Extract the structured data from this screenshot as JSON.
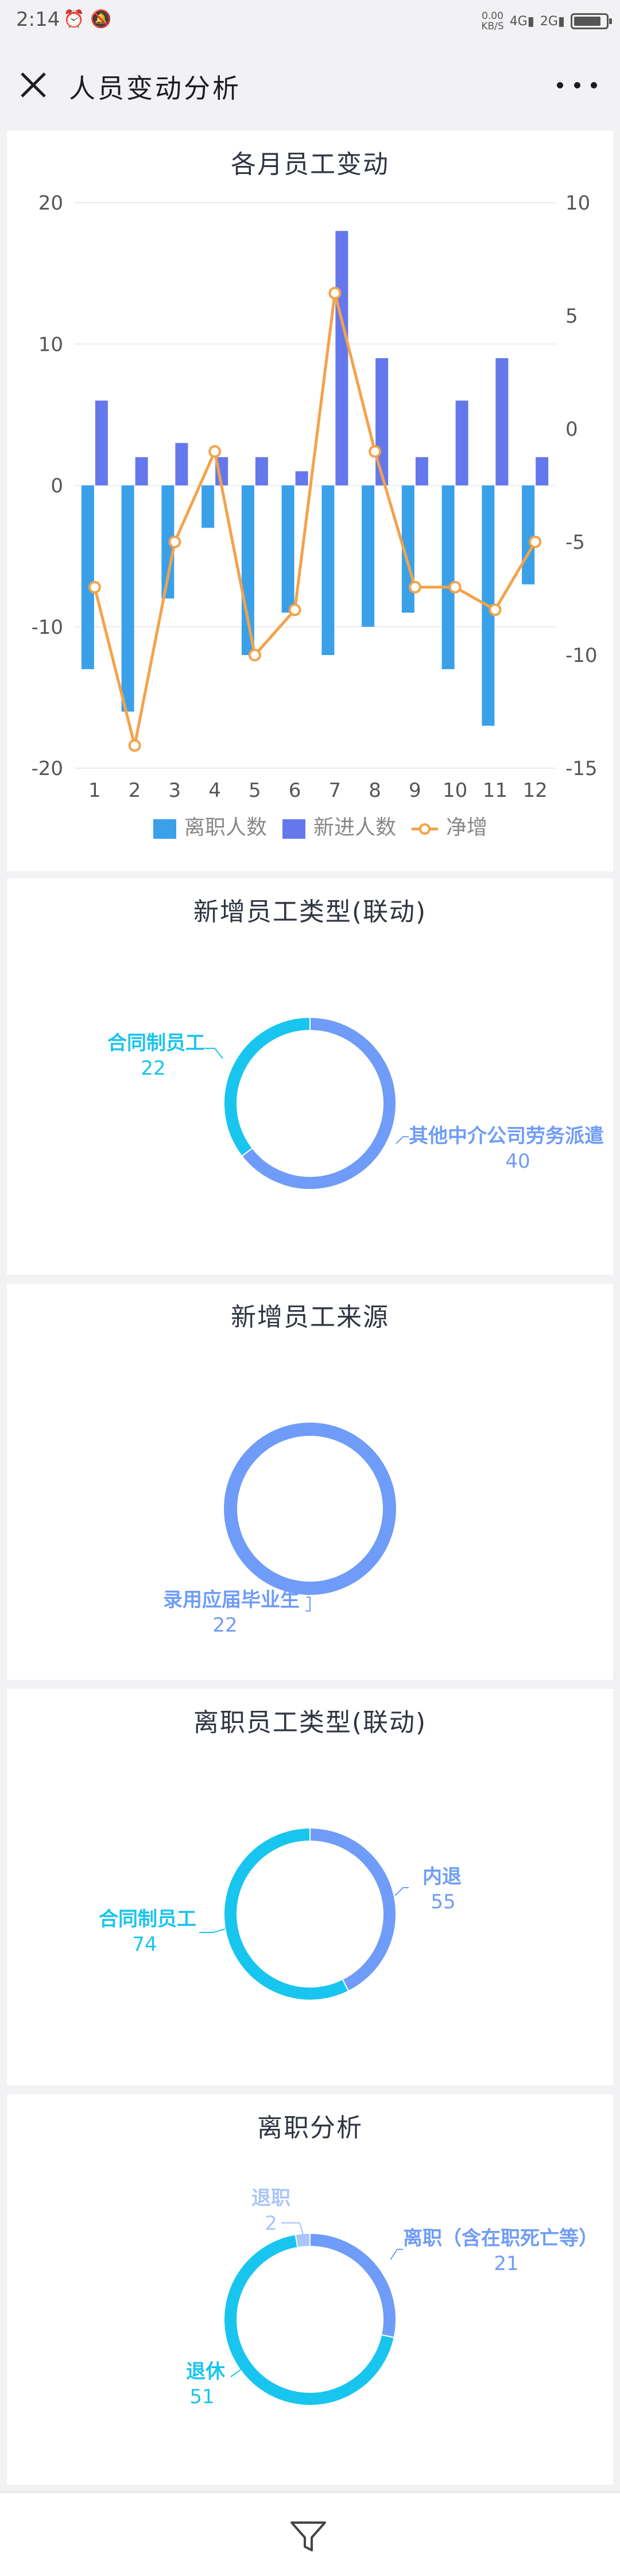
{
  "status_bar": {
    "time": "2:14",
    "net_speed_value": "0.00",
    "net_speed_unit": "KB/S",
    "signal_1": "4G",
    "signal_2": "2G",
    "battery_level": 0.85
  },
  "header": {
    "title": "人员变动分析"
  },
  "colors": {
    "left_bar": "#3aa0e8",
    "right_bar": "#6478ec",
    "line": "#f4a24a",
    "donut_cyan": "#18c5ee",
    "donut_blue": "#6f9cf8",
    "donut_light": "#a9c5fa"
  },
  "monthly": {
    "title": "各月员工变动",
    "chart_data": {
      "type": "bar",
      "categories": [
        "1",
        "2",
        "3",
        "4",
        "5",
        "6",
        "7",
        "8",
        "9",
        "10",
        "11",
        "12"
      ],
      "series": [
        {
          "name": "离职人数",
          "axis": "left",
          "values": [
            -13,
            -16,
            -8,
            -3,
            -12,
            -9,
            -12,
            -10,
            -9,
            -13,
            -17,
            -7
          ]
        },
        {
          "name": "新进人数",
          "axis": "left",
          "values": [
            6,
            2,
            3,
            2,
            2,
            1,
            18,
            9,
            2,
            6,
            9,
            2
          ]
        },
        {
          "name": "净增",
          "axis": "right",
          "type": "line",
          "values": [
            -7,
            -14,
            -5,
            -1,
            -10,
            -8,
            6,
            -1,
            -7,
            -7,
            -8,
            -5
          ]
        }
      ],
      "ylim_left": [
        -20,
        20
      ],
      "yticks_left": [
        "20",
        "10",
        "0",
        "-10",
        "-20"
      ],
      "ylim_right": [
        -15,
        10
      ],
      "yticks_right": [
        "10",
        "5",
        "0",
        "-5",
        "-10",
        "-15"
      ],
      "legend_position": "bottom-center"
    }
  },
  "new_type": {
    "title": "新增员工类型(联动)",
    "chart_data": {
      "type": "pie",
      "slices": [
        {
          "name": "其他中介公司劳务派遣",
          "value": 40
        },
        {
          "name": "合同制员工",
          "value": 22
        }
      ]
    }
  },
  "new_source": {
    "title": "新增员工来源",
    "chart_data": {
      "type": "pie",
      "slices": [
        {
          "name": "录用应届毕业生",
          "value": 22
        }
      ]
    }
  },
  "leave_type": {
    "title": "离职员工类型(联动)",
    "chart_data": {
      "type": "pie",
      "slices": [
        {
          "name": "内退",
          "value": 55
        },
        {
          "name": "合同制员工",
          "value": 74
        }
      ]
    }
  },
  "leave_analysis": {
    "title": "离职分析",
    "chart_data": {
      "type": "pie",
      "slices": [
        {
          "name": "离职（含在职死亡等）",
          "value": 21
        },
        {
          "name": "退休",
          "value": 51
        },
        {
          "name": "退职",
          "value": 2
        }
      ]
    }
  }
}
